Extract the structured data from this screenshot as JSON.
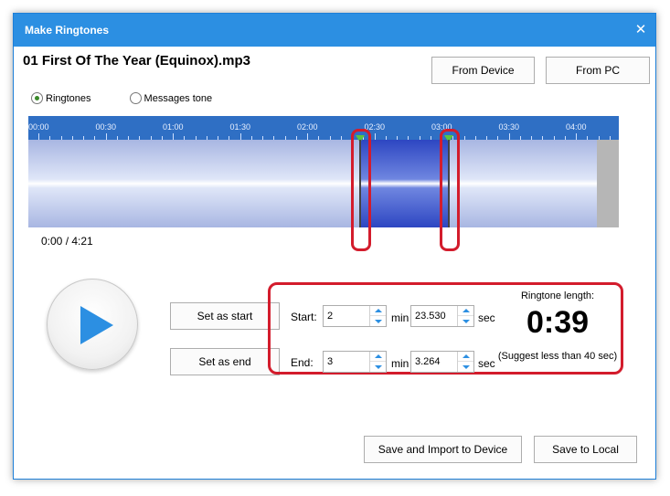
{
  "window": {
    "title": "Make Ringtones",
    "close_glyph": "✕"
  },
  "file_title": "01 First Of The Year (Equinox).mp3",
  "buttons": {
    "from_device": "From Device",
    "from_pc": "From PC",
    "set_start": "Set as start",
    "set_end": "Set as end",
    "save_import": "Save and Import to Device",
    "save_local": "Save to Local"
  },
  "mode": {
    "options": [
      "Ringtones",
      "Messages tone"
    ],
    "selected": "Ringtones"
  },
  "waveform": {
    "tick_labels": [
      "00:00",
      "00:30",
      "01:00",
      "01:30",
      "02:00",
      "02:30",
      "03:00",
      "03:30",
      "04:00"
    ],
    "selection_start_sec": 143.53,
    "selection_end_sec": 183.264,
    "duration_sec": 261
  },
  "time_readout": "0:00 / 4:21",
  "start": {
    "label": "Start:",
    "min": "2",
    "min_unit": "min",
    "sec": "23.530",
    "sec_unit": "sec"
  },
  "end": {
    "label": "End:",
    "min": "3",
    "min_unit": "min",
    "sec": "3.264",
    "sec_unit": "sec"
  },
  "ringtone": {
    "title": "Ringtone length:",
    "value": "0:39",
    "hint": "(Suggest less than 40 sec)"
  },
  "colors": {
    "accent": "#2c8fe2",
    "highlight": "#d31c2c",
    "selection": "#2d46c2",
    "marker": "#5cc43d"
  },
  "icons": {
    "play": "play-icon",
    "close": "close-icon"
  }
}
